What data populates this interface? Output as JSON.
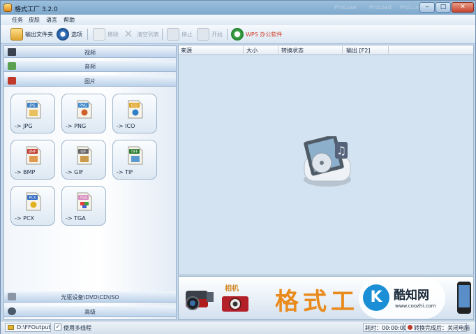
{
  "window": {
    "title": "格式工厂 3.2.0",
    "ghost_tabs": [
      "ProLuxe",
      "ProLoad",
      "ProLuxe"
    ],
    "controls": [
      "–",
      "□",
      "✕"
    ]
  },
  "menu": [
    "任务",
    "皮肤",
    "语言",
    "帮助"
  ],
  "toolbar": {
    "output_folder": "输出文件夹",
    "options": "选项",
    "remove": "移除",
    "clear_list": "清空列表",
    "stop": "停止",
    "start": "开始",
    "wps": "WPS 办公软件"
  },
  "categories": {
    "video": "视频",
    "audio": "音频",
    "image": "图片",
    "rom": "光驱设备\\DVD\\CD\\ISO",
    "advanced": "高级"
  },
  "image_formats": [
    {
      "badge": "JPG",
      "label": "-> JPG",
      "color": "#3b7fc4"
    },
    {
      "badge": "PNG",
      "label": "-> PNG",
      "color": "#3a86c9"
    },
    {
      "badge": "ICO",
      "label": "-> ICO",
      "color": "#e0a52a"
    },
    {
      "badge": "BMP",
      "label": "-> BMP",
      "color": "#c0392b"
    },
    {
      "badge": "GIF",
      "label": "-> GIF",
      "color": "#666666"
    },
    {
      "badge": "TIFF",
      "label": "-> TIF",
      "color": "#2e7d32"
    },
    {
      "badge": "PCX",
      "label": "-> PCX",
      "color": "#3b6fc4"
    },
    {
      "badge": "TGA",
      "label": "-> TGA",
      "color": "#d98ec0"
    }
  ],
  "task_list": {
    "columns": [
      "来源",
      "大小",
      "转换状态",
      "输出 [F2]"
    ]
  },
  "banner": {
    "camera_caption": "相机",
    "slogan": "格式工",
    "watermark_name": "酷知网",
    "watermark_url": "www.coozhi.com"
  },
  "statusbar": {
    "output_path": "D:\\FFOutput",
    "multithread_label": "使用多线程",
    "multithread_checked": true,
    "elapsed": "耗时：00:00:00",
    "after_convert": "转换完成后：关闭电脑"
  }
}
